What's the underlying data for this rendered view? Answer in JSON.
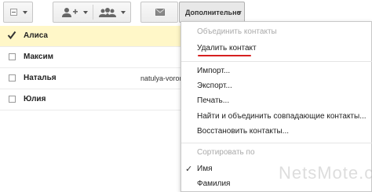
{
  "toolbar": {
    "more_label": "Дополнительно"
  },
  "contacts": [
    {
      "name": "Алиса",
      "email": "",
      "selected": true
    },
    {
      "name": "Максим",
      "email": "",
      "selected": false
    },
    {
      "name": "Наталья",
      "email": "natulya-voron",
      "selected": false
    },
    {
      "name": "Юлия",
      "email": "",
      "selected": false
    }
  ],
  "menu": {
    "merge": "Объединить контакты",
    "delete": "Удалить контакт",
    "import": "Импорт...",
    "export": "Экспорт...",
    "print": "Печать...",
    "find_merge": "Найти и объединить совпадающие контакты...",
    "restore": "Восстановить контакты...",
    "sort_header": "Сортировать по",
    "sort_name": "Имя",
    "sort_surname": "Фамилия",
    "sort_check": "✓"
  },
  "watermark": "NetsMote.com",
  "colors": {
    "selected_row": "#fff7c8",
    "underline": "#d62020"
  },
  "icons": {
    "select": "checkbox-icon",
    "add_contact": "person-add-icon",
    "add_group": "group-add-icon",
    "email": "envelope-icon"
  }
}
